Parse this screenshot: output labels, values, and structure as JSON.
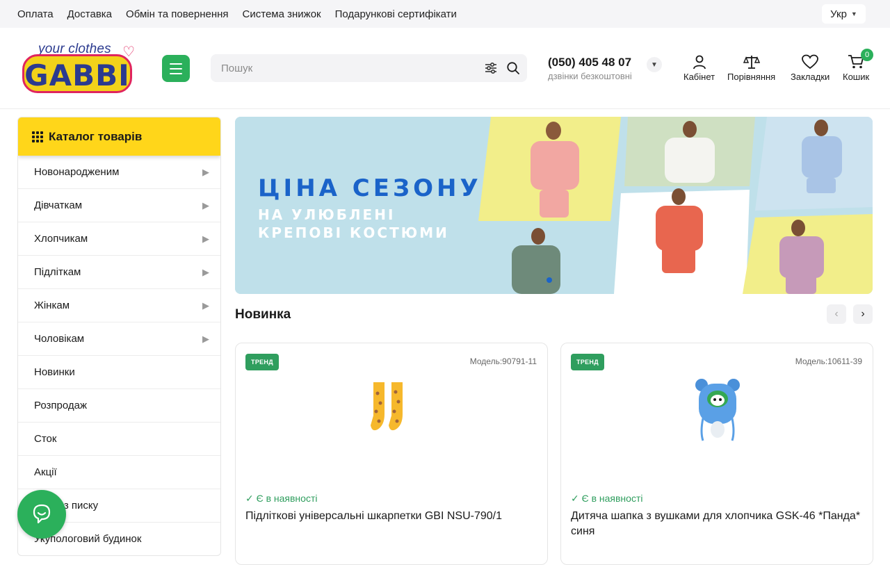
{
  "topnav": {
    "links": [
      "Оплата",
      "Доставка",
      "Обмін та повернення",
      "Система знижок",
      "Подарункові сертифікати"
    ],
    "lang": "Укр"
  },
  "header": {
    "logo_tagline": "your clothes",
    "logo_brand": "GABBI",
    "search_placeholder": "Пошук",
    "phone": "(050) 405 48 07",
    "phone_sub": "дзвінки безкоштовні",
    "icons": {
      "cabinet": "Кабінет",
      "compare": "Порівняння",
      "bookmarks": "Закладки",
      "cart": "Кошик",
      "cart_count": "0"
    }
  },
  "catalog": {
    "title": "Каталог товарів",
    "items": [
      "Новонародженим",
      "Дівчаткам",
      "Хлопчикам",
      "Підліткам",
      "Жінкам",
      "Чоловікам",
      "Новинки",
      "Розпродаж",
      "Сток",
      "Акції",
      "Виріб з писку",
      "Укупологовий будинок"
    ],
    "arrow": "▶"
  },
  "banner": {
    "headline": "ЦІНА СЕЗОНУ",
    "line1": "НА УЛЮБЛЕНІ",
    "line2": "КРЕПОВІ КОСТЮМИ",
    "colors": {
      "bg": "#bfe0ea",
      "headline": "#1a63c9",
      "yellow": "#f2ee8a",
      "sage": "#cfe0c2"
    }
  },
  "section": {
    "title": "Новинка",
    "prev": "‹",
    "next": "›"
  },
  "products": [
    {
      "badge": "ТРЕНД",
      "model": "Модель:90791-11",
      "stock": "✓ Є в наявності",
      "name": "Підліткові універсальні шкарпетки GBI NSU-790/1",
      "image": "yellow-socks"
    },
    {
      "badge": "ТРЕНД",
      "model": "Модель:10611-39",
      "stock": "✓ Є в наявності",
      "name": "Дитяча шапка з вушками для хлопчика GSK-46 *Панда* синя",
      "image": "blue-panda-hat"
    }
  ],
  "accent": "#2bb05b"
}
